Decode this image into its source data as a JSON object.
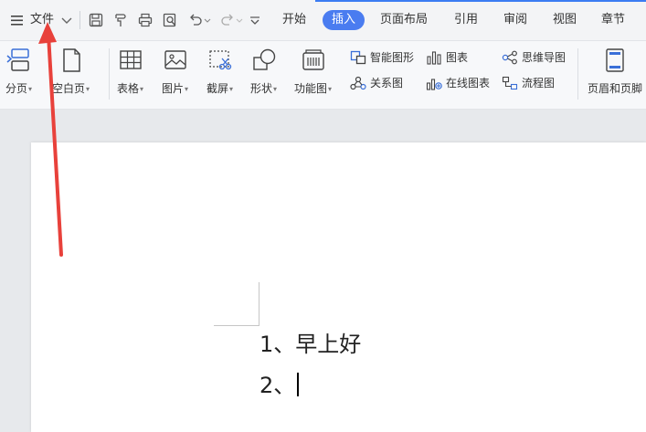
{
  "topbar": {
    "menu_label": "文件",
    "tabs": [
      "开始",
      "插入",
      "页面布局",
      "引用",
      "审阅",
      "视图",
      "章节"
    ],
    "active_tab": "插入"
  },
  "ribbon": {
    "page_break": "分页",
    "blank_page": "空白页",
    "table": "表格",
    "picture": "图片",
    "screenshot": "截屏",
    "shape": "形状",
    "function_chart": "功能图",
    "smart_shape": "智能图形",
    "chart": "图表",
    "mind_map": "思维导图",
    "relation_chart": "关系图",
    "online_chart": "在线图表",
    "flowchart": "流程图",
    "header_footer": "页眉和页脚"
  },
  "document": {
    "line1": "1、早上好",
    "line2": "2、"
  },
  "colors": {
    "accent": "#4a7cf0",
    "annotation_arrow": "#e8413b"
  }
}
